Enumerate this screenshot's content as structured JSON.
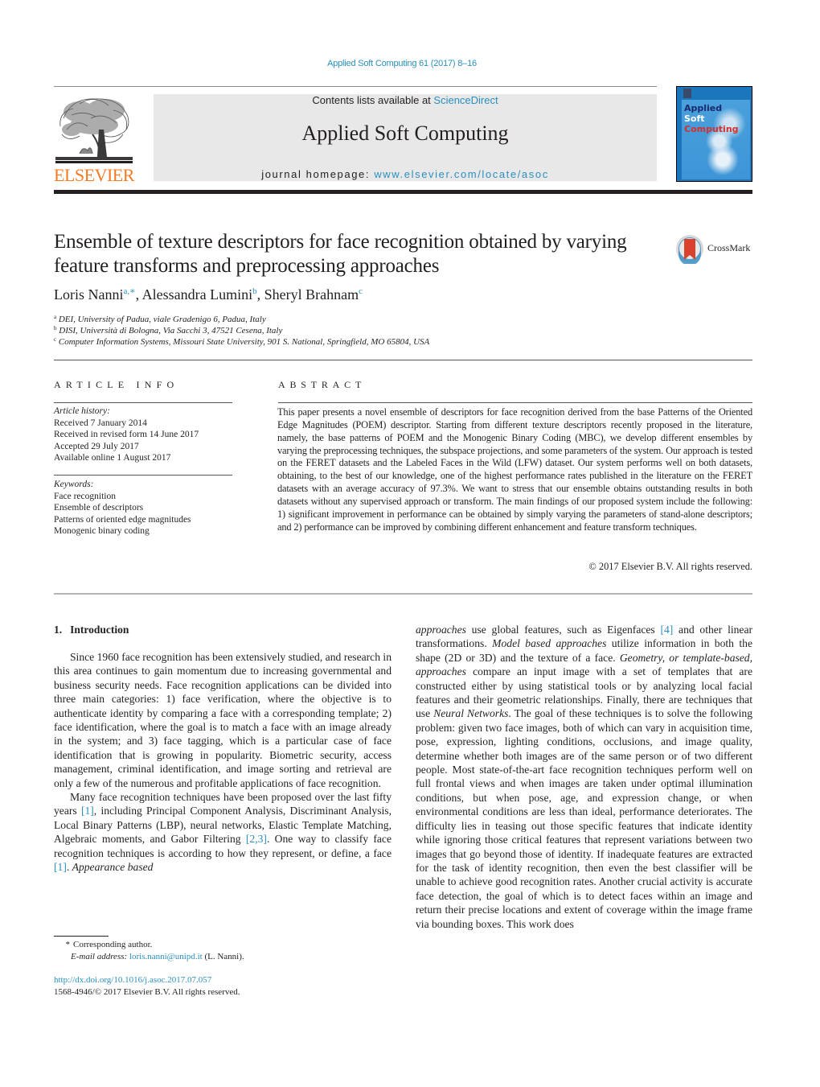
{
  "header": {
    "journal_reference": "Applied Soft Computing 61 (2017) 8–16",
    "contents_prefix": "Contents lists available at ",
    "contents_link": "ScienceDirect",
    "journal_title": "Applied Soft Computing",
    "homepage_prefix": "journal homepage: ",
    "homepage_link": "www.elsevier.com/locate/asoc",
    "publisher_logo_text": "ELSEVIER",
    "cover": {
      "line1": "Applied",
      "line2": "Soft",
      "line3": "Computing"
    },
    "colors": {
      "link": "#2a8fbd",
      "elsevier_orange": "#f47920",
      "cover_blue": "#1c76bb"
    }
  },
  "article": {
    "title": "Ensemble of texture descriptors for face recognition obtained by varying feature transforms and preprocessing approaches",
    "crossmark_label": "CrossMark",
    "authors": [
      {
        "name": "Loris Nanni",
        "sup": "a,∗"
      },
      {
        "name": "Alessandra Lumini",
        "sup": "b"
      },
      {
        "name": "Sheryl Brahnam",
        "sup": "c"
      }
    ],
    "affiliations": [
      {
        "key": "a",
        "text": "DEI, University of Padua, viale Gradenigo 6, Padua, Italy"
      },
      {
        "key": "b",
        "text": "DISI, Università di Bologna, Via Sacchi 3, 47521 Cesena, Italy"
      },
      {
        "key": "c",
        "text": "Computer Information Systems, Missouri State University, 901 S. National, Springfield, MO 65804, USA"
      }
    ]
  },
  "article_info": {
    "heading": "ARTICLE INFO",
    "history_label": "Article history:",
    "history": [
      "Received 7 January 2014",
      "Received in revised form 14 June 2017",
      "Accepted 29 July 2017",
      "Available online 1 August 2017"
    ],
    "keywords_label": "Keywords:",
    "keywords": [
      "Face recognition",
      "Ensemble of descriptors",
      "Patterns of oriented edge magnitudes",
      "Monogenic binary coding"
    ]
  },
  "abstract": {
    "heading": "ABSTRACT",
    "text": "This paper presents a novel ensemble of descriptors for face recognition derived from the base Patterns of the Oriented Edge Magnitudes (POEM) descriptor. Starting from different texture descriptors recently proposed in the literature, namely, the base patterns of POEM and the Monogenic Binary Coding (MBC), we develop different ensembles by varying the preprocessing techniques, the subspace projections, and some parameters of the system. Our approach is tested on the FERET datasets and the Labeled Faces in the Wild (LFW) dataset. Our system performs well on both datasets, obtaining, to the best of our knowledge, one of the highest performance rates published in the literature on the FERET datasets with an average accuracy of 97.3%. We want to stress that our ensemble obtains outstanding results in both datasets without any supervised approach or transform. The main findings of our proposed system include the following: 1) significant improvement in performance can be obtained by simply varying the parameters of stand-alone descriptors; and 2) performance can be improved by combining different enhancement and feature transform techniques.",
    "copyright": "© 2017 Elsevier B.V. All rights reserved."
  },
  "body": {
    "section_number": "1.",
    "section_title": "Introduction",
    "left_p1": "Since 1960 face recognition has been extensively studied, and research in this area continues to gain momentum due to increasing governmental and business security needs. Face recognition applications can be divided into three main categories: 1) face verification, where the objective is to authenticate identity by comparing a face with a corresponding template; 2) face identification, where the goal is to match a face with an image already in the system; and 3) face tagging, which is a particular case of face identification that is growing in popularity. Biometric security, access management, criminal identification, and image sorting and retrieval are only a few of the numerous and profitable applications of face recognition.",
    "left_p2_a": "Many face recognition techniques have been proposed over the last fifty years ",
    "left_p2_ref1": "[1]",
    "left_p2_b": ", including Principal Component Analysis, Discriminant Analysis, Local Binary Patterns (LBP), neural networks, Elastic Template Matching, Algebraic moments, and Gabor Filtering ",
    "left_p2_ref2": "[2,3]",
    "left_p2_c": ". One way to classify face recognition techniques is according to how they represent, or define, a face ",
    "left_p2_ref3": "[1]",
    "left_p2_d": ". ",
    "left_p2_italic": "Appearance based",
    "right_italic1": "approaches",
    "right_a": " use global features, such as Eigenfaces ",
    "right_ref4": "[4]",
    "right_b": " and other linear transformations. ",
    "right_italic2": "Model based approaches",
    "right_c": " utilize information in both the shape (2D or 3D) and the texture of a face. ",
    "right_italic3": "Geometry, or template-based, approaches",
    "right_d": " compare an input image with a set of templates that are constructed either by using statistical tools or by analyzing local facial features and their geometric relationships. Finally, there are techniques that use ",
    "right_italic4": "Neural Networks",
    "right_e": ". The goal of these techniques is to solve the following problem: given two face images, both of which can vary in acquisition time, pose, expression, lighting conditions, occlusions, and image quality, determine whether both images are of the same person or of two different people. Most state-of-the-art face recognition techniques perform well on full frontal views and when images are taken under optimal illumination conditions, but when pose, age, and expression change, or when environmental conditions are less than ideal, performance deteriorates. The difficulty lies in teasing out those specific features that indicate identity while ignoring those critical features that represent variations between two images that go beyond those of identity. If inadequate features are extracted for the task of identity recognition, then even the best classifier will be unable to achieve good recognition rates. Another crucial activity is accurate face detection, the goal of which is to detect faces within an image and return their precise locations and extent of coverage within the image frame via bounding boxes. This work does"
  },
  "footnote": {
    "star": "*",
    "corresponding": "Corresponding author.",
    "email_label": "E-mail address:",
    "email": "loris.nanni@unipd.it",
    "email_suffix": " (L. Nanni).",
    "doi": "http://dx.doi.org/10.1016/j.asoc.2017.07.057",
    "issn_copyright": "1568-4946/© 2017 Elsevier B.V. All rights reserved."
  }
}
